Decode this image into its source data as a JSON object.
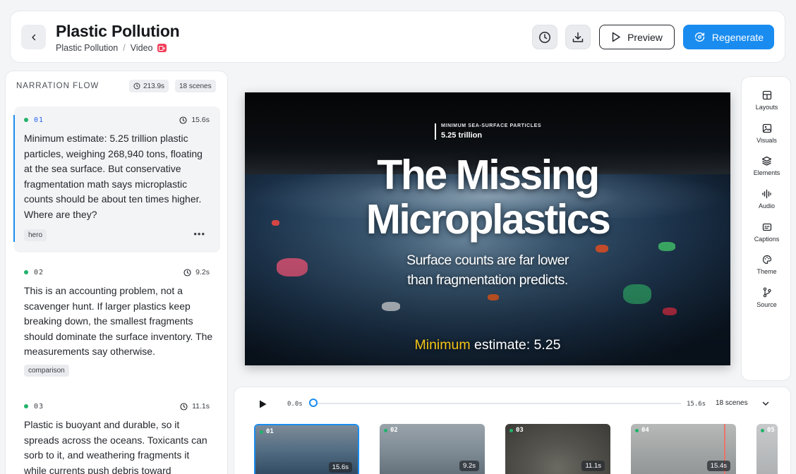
{
  "header": {
    "title": "Plastic Pollution",
    "breadcrumb": {
      "project": "Plastic Pollution",
      "separator": "/",
      "section": "Video"
    },
    "preview_label": "Preview",
    "regenerate_label": "Regenerate",
    "accent_color": "#1a8cf0"
  },
  "narration": {
    "heading": "NARRATION FLOW",
    "total_duration": "213.9s",
    "scene_count": "18 scenes",
    "scenes": [
      {
        "number": "01",
        "duration": "15.6s",
        "text": "Minimum estimate: 5.25 trillion plastic particles, weighing 268,940 tons, floating at the sea surface. But conservative fragmentation math says microplastic counts should be about ten times higher. Where are they?",
        "tag": "hero",
        "more": "•••"
      },
      {
        "number": "02",
        "duration": "9.2s",
        "text": "This is an accounting problem, not a scavenger hunt. If larger plastics keep breaking down, the smallest fragments should dominate the surface inventory. The measurements say otherwise.",
        "tag": "comparison"
      },
      {
        "number": "03",
        "duration": "11.1s",
        "text": "Plastic is buoyant and durable, so it spreads across the oceans. Toxicants can sorb to it, and weathering fragments it while currents push debris toward"
      }
    ]
  },
  "video": {
    "stat_label": "MINIMUM SEA-SURFACE PARTICLES",
    "stat_value": "5.25 trillion",
    "title_line1": "The Missing",
    "title_line2": "Microplastics",
    "subtitle_line1": "Surface counts are far lower",
    "subtitle_line2": "than fragmentation predicts.",
    "caption_highlight": "Minimum",
    "caption_rest": "estimate: 5.25",
    "caption_highlight_color": "#f5c518"
  },
  "tools": [
    "Layouts",
    "Visuals",
    "Elements",
    "Audio",
    "Captions",
    "Theme",
    "Source"
  ],
  "timeline": {
    "start": "0.0s",
    "end": "15.6s",
    "scenes_label": "18 scenes",
    "thumbnails": [
      {
        "number": "01",
        "duration": "15.6s",
        "selected": true
      },
      {
        "number": "02",
        "duration": "9.2s"
      },
      {
        "number": "03",
        "duration": "11.1s"
      },
      {
        "number": "04",
        "duration": "15.4s"
      },
      {
        "number": "05"
      }
    ]
  }
}
